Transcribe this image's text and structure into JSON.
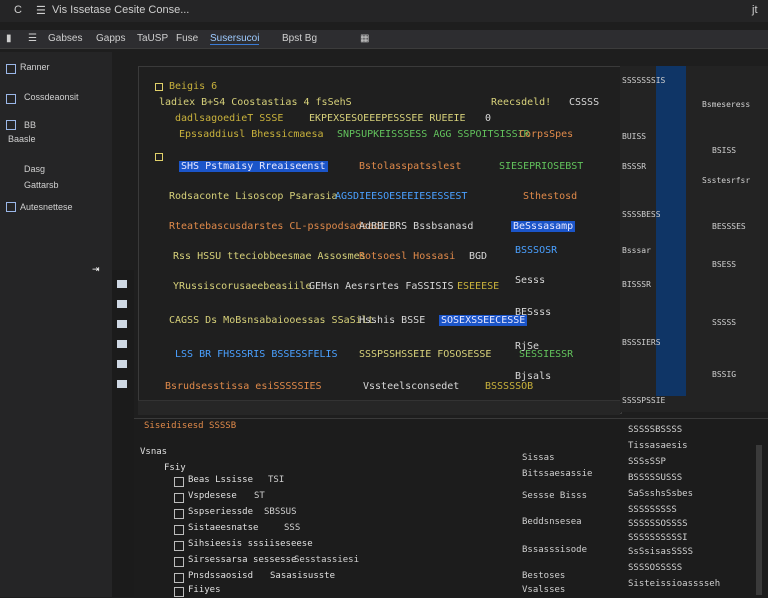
{
  "titlebar": {
    "letter": "C",
    "title": "Vis Issetase Cesite Conse...",
    "right": "jt"
  },
  "toolbar": {
    "items": [
      "Gabses",
      "Gapps",
      "TaUSP",
      "Fuse",
      "Susersucoi",
      "Bpst Bg"
    ]
  },
  "sidebar": {
    "items": [
      "Ranner",
      "Cossdeaonsit",
      "BB",
      "Baasle",
      "Dasg",
      "Gattarsb",
      "Autesnettese"
    ]
  },
  "editor": {
    "lines": [
      {
        "a": "Beigis 6",
        "b": "",
        "c": ""
      },
      {
        "a": "ladiex B+S4 Coostastias 4 fsSehS",
        "b": "Reecsdeld!",
        "c": "CSSSS"
      },
      {
        "a": "dadlsagoedieT SSSE",
        "b": "EKPEXSESOEEEPESSSEE RUEEIE",
        "c": "0"
      },
      {
        "a": "Epssaddiusl Bhessicmaesa",
        "b": "SNPSUPKEISSSESS AGG SSPOITSISSIR",
        "c": "CorpsSpes"
      },
      {
        "a": "SHS Pstmaisy Rreaiseenst",
        "b": "Bstolasspatsslest",
        "c": "SIESEPRIOSEBST"
      },
      {
        "a": "Rodsaconte Lisoscop Psarasia",
        "b": "AGSDIEESOESEEIESESSEST",
        "c": "Sthestosd"
      },
      {
        "a": "Rteatebascusdarstes CL-psspodsadsadi",
        "b": "AdBBEBRS Bssbsanasd",
        "c": "BeSssasamp"
      },
      {
        "a": "Rss HSSU tteciobbeesmae Assosmes",
        "b": "Rotsoesl Hossasi",
        "c": "BGD"
      },
      {
        "a": "YRussiscorusaeebeasiile",
        "b": "GEHsn Aesrsrtes FaSSISIS",
        "c": "ESEEESE"
      },
      {
        "a": "CAGSS Ds MoBsnsabaiooessas SSaSilt",
        "b": "Hsshis BSSE",
        "c": "SOSEXSSEECESSE"
      },
      {
        "a": "LSS BR FHSSSRIS BSSESSFELIS",
        "b": "SSSPSSHSSEIE FOSOSESSE",
        "c": "SESSIESSR"
      },
      {
        "a": "Bsrudsesstissa esiSSSSSIES",
        "b": "Vssteelsconsedet",
        "c": "BSSSSSOB"
      }
    ],
    "side_labels": [
      "BSSSOSR",
      "Sesss",
      "BESsss",
      "RjSe",
      "Bjsals"
    ]
  },
  "right_panel": {
    "lines": [
      "SSSSSSSIS",
      "Bsmeseress",
      "BUISS",
      "BSISS",
      "BSSSR",
      "Ssstesrfsr",
      "SSSSBESS",
      "BESSSES",
      "Bsssar",
      "BSESS",
      "BISSSR",
      "SSSSS",
      "BSSSIERS",
      "BSSIG",
      "SSSSPSSIE"
    ]
  },
  "bottom_panel": {
    "title": "Siseidisesd SSSSB",
    "tree_root": "Vsnas",
    "tree_child": "Fsiy",
    "rows": [
      {
        "label": "Beas Lssisse",
        "tag": "TSI"
      },
      {
        "label": "Vspdesese",
        "tag": "ST"
      },
      {
        "label": "Sspseriessde",
        "tag": "SBSSUS"
      },
      {
        "label": "Sistaeesnatse",
        "tag": "SSS"
      },
      {
        "label": "Sihsieesis sssiiseseese",
        "tag": ""
      },
      {
        "label": "Sirsessarsa sessesse",
        "tag": "Sesstassiesi"
      },
      {
        "label": "Pnsdssaosisd",
        "tag": "Sasasisusste"
      },
      {
        "label": "Fiiyes",
        "tag": ""
      }
    ],
    "middle": [
      "Sissas",
      "Bitssaesassie",
      "Sessse Bisss",
      "Beddsnsesea",
      "Bssasssisode",
      "Bestoses",
      "Vsalsses",
      "Bssisdaisis"
    ],
    "right": [
      "SSSSSBSSSS",
      "Tissasaesis",
      "SSSsSSP",
      "BSSSSSUSSS",
      "SaSsshsSsbes",
      "SSSSSSSSS",
      "SSSSSSOSSSS",
      "SSSSSSSSSSI",
      "SsSsisasSSSS",
      "SSSSOSSSSS",
      "Sisteissioasssseh"
    ]
  },
  "colors": {
    "accent": "#1b55c9",
    "keyword": "#c9b23c",
    "string": "#e08a4a",
    "link": "#4aa0ff"
  }
}
